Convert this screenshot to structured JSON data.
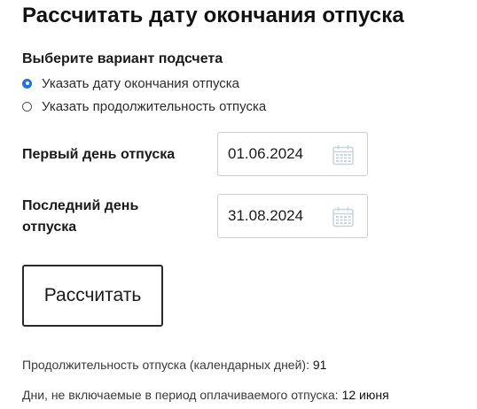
{
  "page": {
    "title": "Рассчитать дату окончания отпуска"
  },
  "mode": {
    "label": "Выберите вариант подсчета",
    "options": [
      {
        "label": "Указать дату окончания отпуска",
        "selected": true
      },
      {
        "label": "Указать продолжительность отпуска",
        "selected": false
      }
    ]
  },
  "fields": {
    "first_day": {
      "label": "Первый день отпуска",
      "value": "01.06.2024",
      "icon": "calendar-icon"
    },
    "last_day": {
      "label": "Последний день отпуска",
      "value": "31.08.2024",
      "icon": "calendar-icon"
    }
  },
  "actions": {
    "calculate_label": "Рассчитать"
  },
  "results": {
    "duration_label": "Продолжительность отпуска (календарных дней):",
    "duration_value": "91",
    "excluded_label": "Дни, не включаемые в период оплачиваемого отпуска:",
    "excluded_value": "12 июня"
  },
  "colors": {
    "accent": "#1a73e8",
    "text": "#1a1a1a",
    "border": "#cfcfcf",
    "icon": "#c8d4e0"
  }
}
